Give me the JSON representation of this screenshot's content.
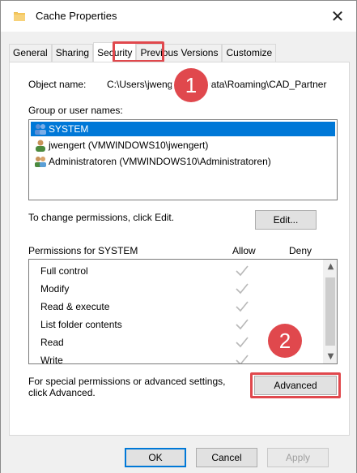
{
  "window": {
    "title": "Cache Properties",
    "close_glyph": "✕"
  },
  "tabs": [
    {
      "label": "General"
    },
    {
      "label": "Sharing"
    },
    {
      "label": "Security"
    },
    {
      "label": "Previous Versions"
    },
    {
      "label": "Customize"
    }
  ],
  "security": {
    "object_name_label": "Object name:",
    "object_name_value": "C:\\Users\\jwengert\\AppData\\Roaming\\CAD_Partner",
    "group_label": "Group or user names:",
    "users": [
      {
        "name": "SYSTEM",
        "icon": "users-group-icon"
      },
      {
        "name": "jwengert (VMWINDOWS10\\jwengert)",
        "icon": "user-icon"
      },
      {
        "name": "Administratoren (VMWINDOWS10\\Administratoren)",
        "icon": "users-group-icon"
      }
    ],
    "change_hint": "To change permissions, click Edit.",
    "edit_button": "Edit...",
    "permissions_label": "Permissions for SYSTEM",
    "allow_header": "Allow",
    "deny_header": "Deny",
    "permissions": [
      {
        "name": "Full control",
        "allow": true
      },
      {
        "name": "Modify",
        "allow": true
      },
      {
        "name": "Read & execute",
        "allow": true
      },
      {
        "name": "List folder contents",
        "allow": true
      },
      {
        "name": "Read",
        "allow": true
      },
      {
        "name": "Write",
        "allow": true
      }
    ],
    "special_hint_line1": "For special permissions or advanced settings,",
    "special_hint_line2": "click Advanced.",
    "advanced_button": "Advanced"
  },
  "footer": {
    "ok": "OK",
    "cancel": "Cancel",
    "apply": "Apply"
  },
  "annotations": {
    "badge1": "1",
    "badge2": "2",
    "color": "#e0484d"
  },
  "colors": {
    "selection": "#0078d7",
    "check": "#b8b8b8"
  }
}
